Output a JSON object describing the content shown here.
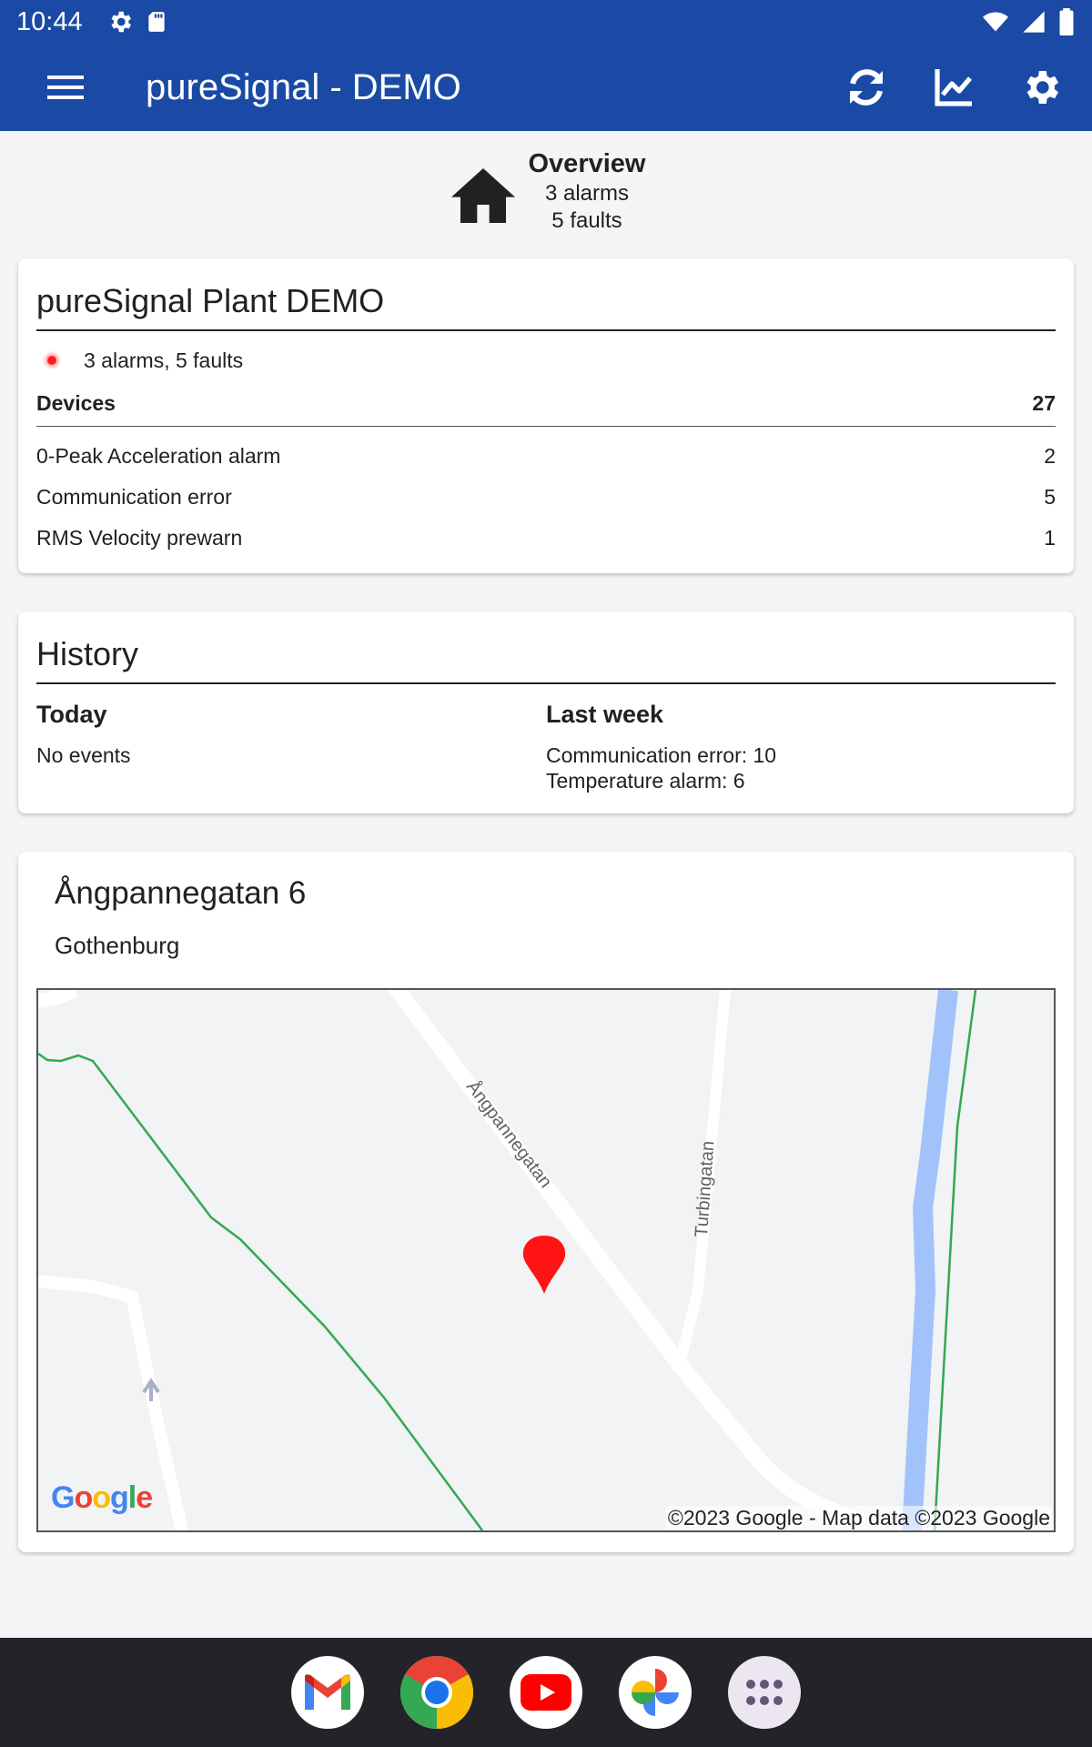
{
  "status_bar": {
    "time": "10:44"
  },
  "app_bar": {
    "title": "pureSignal - DEMO"
  },
  "overview": {
    "title": "Overview",
    "alarms": "3 alarms",
    "faults": "5 faults"
  },
  "plant": {
    "name": "pureSignal Plant DEMO",
    "status": "3 alarms, 5 faults",
    "status_color": "#ff1a1a",
    "devices_label": "Devices",
    "devices_count": "27",
    "items": [
      {
        "label": "0-Peak Acceleration alarm",
        "count": "2"
      },
      {
        "label": "Communication error",
        "count": "5"
      },
      {
        "label": "RMS Velocity prewarn",
        "count": "1"
      }
    ]
  },
  "history": {
    "title": "History",
    "today_label": "Today",
    "today_lines": [
      "No events"
    ],
    "last_week_label": "Last week",
    "last_week_lines": [
      "Communication error: 10",
      "Temperature alarm: 6"
    ]
  },
  "location": {
    "street": "Ångpannegatan 6",
    "city": "Gothenburg",
    "map": {
      "road_label_1": "Ångpannegatan",
      "road_label_2": "Turbingatan",
      "copyright": "©2023 Google - Map data ©2023 Google",
      "logo_text": "Google"
    }
  },
  "colors": {
    "primary": "#1a4aa6",
    "alarm": "#ff1a1a",
    "dock": "#24232a"
  },
  "icons": {
    "app_bar": [
      "menu-icon",
      "refresh-icon",
      "chart-icon",
      "settings-icon"
    ],
    "dock": [
      "gmail-icon",
      "chrome-icon",
      "youtube-icon",
      "photos-icon",
      "apps-icon"
    ]
  }
}
